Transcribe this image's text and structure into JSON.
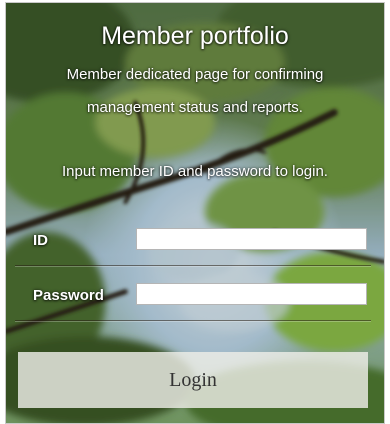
{
  "panel": {
    "title": "Member portfolio",
    "description_line1": "Member dedicated page for confirming",
    "description_line2": "management status and reports.",
    "instruction": "Input member ID and password to login."
  },
  "form": {
    "id_label": "ID",
    "id_value": "",
    "password_label": "Password",
    "password_value": "",
    "login_label": "Login"
  },
  "colors": {
    "text": "#ffffff",
    "button_bg": "#eeeee8",
    "button_text": "#333333",
    "input_border": "#b5b5b5"
  }
}
